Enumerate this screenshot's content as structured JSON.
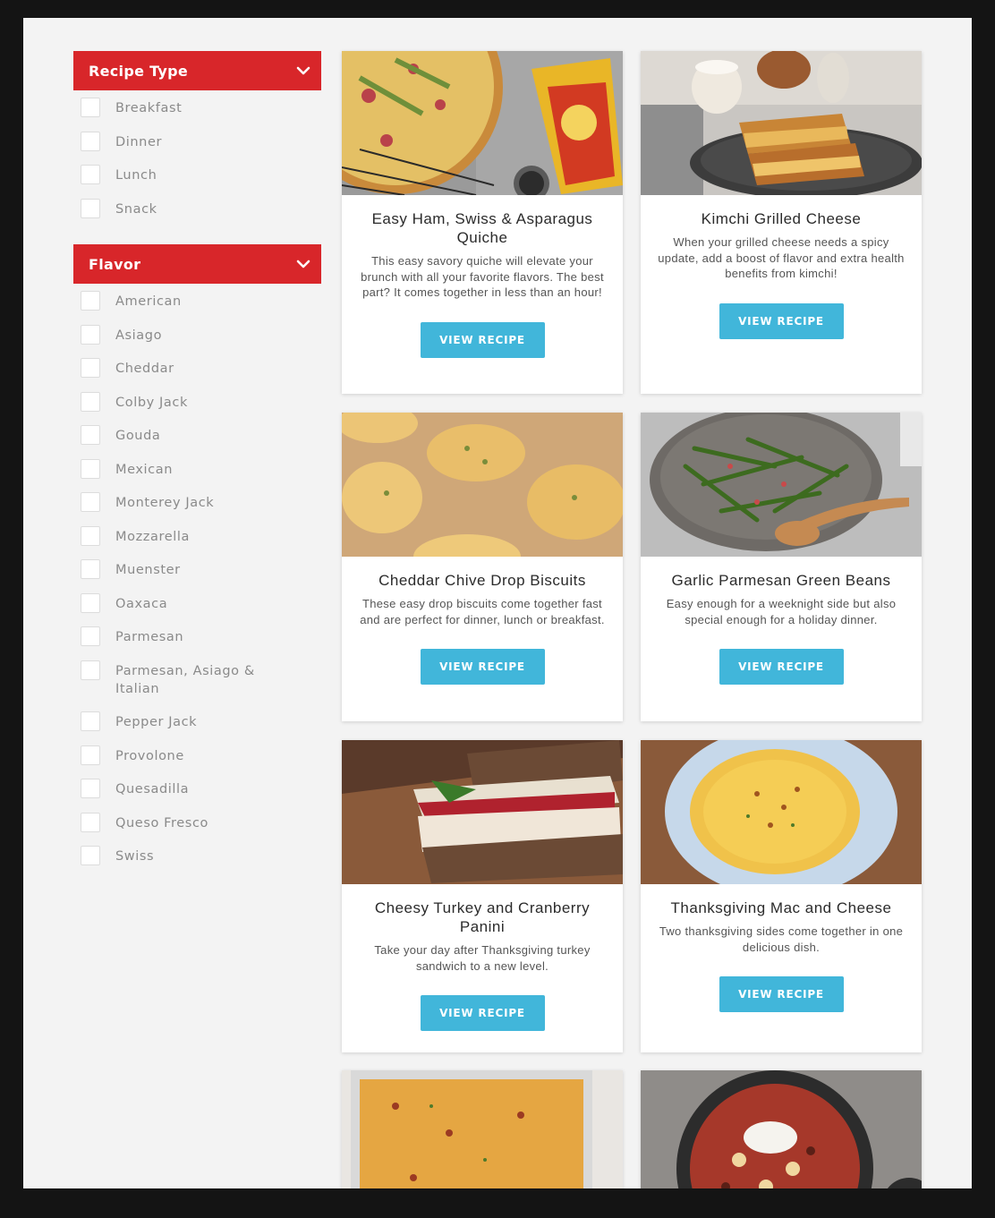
{
  "colors": {
    "accent_red": "#d8262a",
    "button_blue": "#41b6da",
    "page_bg": "#f3f3f3"
  },
  "sidebar": {
    "recipe_type": {
      "title": "Recipe Type",
      "icon": "chevron-down-icon",
      "options": [
        "Breakfast",
        "Dinner",
        "Lunch",
        "Snack"
      ]
    },
    "flavor": {
      "title": "Flavor",
      "icon": "chevron-down-icon",
      "options": [
        "American",
        "Asiago",
        "Cheddar",
        "Colby Jack",
        "Gouda",
        "Mexican",
        "Monterey Jack",
        "Mozzarella",
        "Muenster",
        "Oaxaca",
        "Parmesan",
        "Parmesan, Asiago & Italian",
        "Pepper Jack",
        "Provolone",
        "Quesadilla",
        "Queso Fresco",
        "Swiss"
      ]
    }
  },
  "recipes": [
    {
      "title": "Easy Ham, Swiss & Asparagus Quiche",
      "description": "This easy savory quiche will elevate your brunch with all your favorite flavors. The best part? It comes together in less than an hour!",
      "button": "VIEW RECIPE",
      "image": "quiche-photo"
    },
    {
      "title": "Kimchi Grilled Cheese",
      "description": "When your grilled cheese needs a spicy update, add a boost of flavor and extra health benefits from kimchi!",
      "button": "VIEW RECIPE",
      "image": "grilled-cheese-photo"
    },
    {
      "title": "Cheddar Chive Drop Biscuits",
      "description": "These easy drop biscuits come together fast and are perfect for dinner, lunch or breakfast.",
      "button": "VIEW RECIPE",
      "image": "biscuits-photo"
    },
    {
      "title": "Garlic Parmesan Green Beans",
      "description": "Easy enough for a weeknight side but also special enough for a holiday dinner.",
      "button": "VIEW RECIPE",
      "image": "green-beans-photo"
    },
    {
      "title": "Cheesy Turkey and Cranberry Panini",
      "description": "Take your day after Thanksgiving turkey sandwich to a new level.",
      "button": "VIEW RECIPE",
      "image": "panini-photo"
    },
    {
      "title": "Thanksgiving Mac and Cheese",
      "description": "Two thanksgiving sides come together in one delicious dish.",
      "button": "VIEW RECIPE",
      "image": "mac-and-cheese-photo"
    },
    {
      "title": "",
      "description": "",
      "button": "",
      "image": "casserole-photo"
    },
    {
      "title": "",
      "description": "",
      "button": "",
      "image": "chili-photo"
    }
  ]
}
